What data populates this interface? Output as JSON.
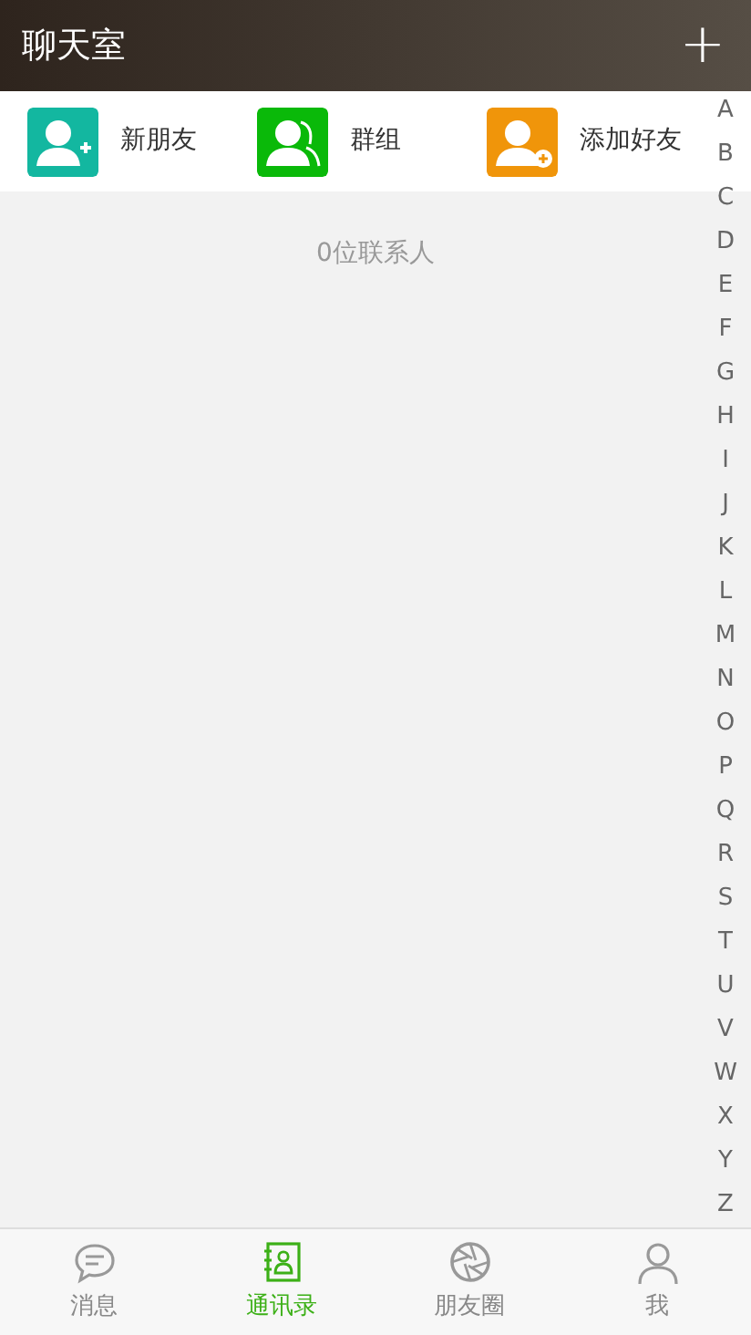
{
  "header": {
    "title": "聊天室",
    "add_icon": "+"
  },
  "shortcuts": [
    {
      "kind": "new-friend",
      "label": "新朋友",
      "color": "#13b7a0"
    },
    {
      "kind": "group",
      "label": "群组",
      "color": "#0ab909"
    },
    {
      "kind": "add-friend",
      "label": "添加好友",
      "color": "#f0950a"
    }
  ],
  "contact_count": "0位联系人",
  "index_letters": [
    "A",
    "B",
    "C",
    "D",
    "E",
    "F",
    "G",
    "H",
    "I",
    "J",
    "K",
    "L",
    "M",
    "N",
    "O",
    "P",
    "Q",
    "R",
    "S",
    "T",
    "U",
    "V",
    "W",
    "X",
    "Y",
    "Z"
  ],
  "tabs": [
    {
      "kind": "chat",
      "label": "消息",
      "selected": false
    },
    {
      "kind": "contacts",
      "label": "通讯录",
      "selected": true
    },
    {
      "kind": "moments",
      "label": "朋友圈",
      "selected": false
    },
    {
      "kind": "me",
      "label": "我",
      "selected": false
    }
  ]
}
